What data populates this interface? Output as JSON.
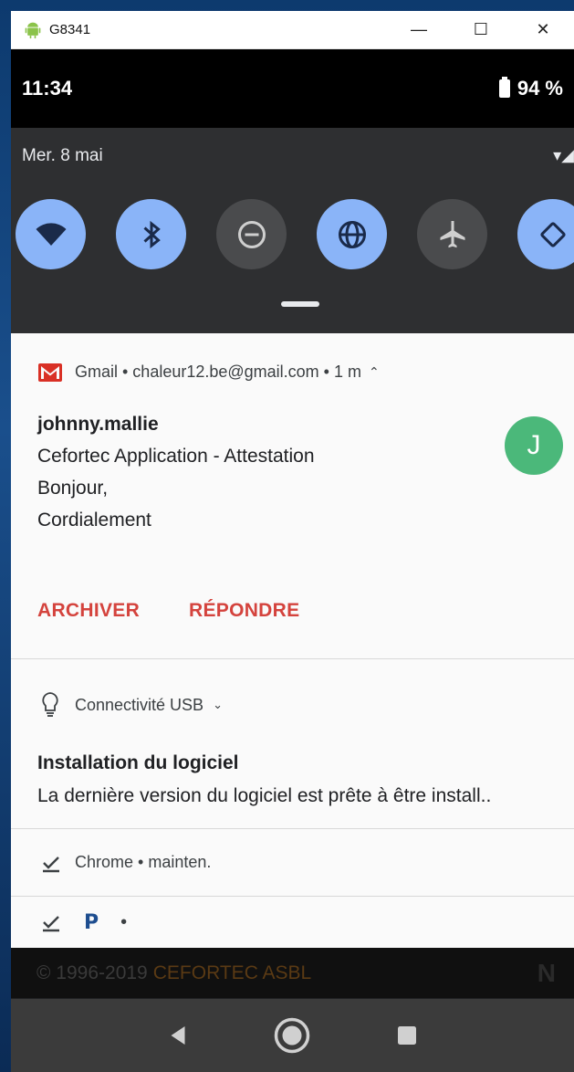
{
  "window": {
    "title": "G8341"
  },
  "statusbar": {
    "time": "11:34",
    "battery": "94 %"
  },
  "quick_settings": {
    "date": "Mer. 8 mai",
    "tiles": [
      {
        "name": "wifi",
        "state": "on"
      },
      {
        "name": "bluetooth",
        "state": "on"
      },
      {
        "name": "do-not-disturb",
        "state": "off"
      },
      {
        "name": "data-globe",
        "state": "on"
      },
      {
        "name": "airplane-mode",
        "state": "off"
      },
      {
        "name": "auto-rotate",
        "state": "on"
      }
    ]
  },
  "gmail": {
    "header": "Gmail • chaleur12.be@gmail.com • 1 m",
    "sender": "johnny.mallie",
    "subject": "Cefortec Application - Attestation",
    "line1": "Bonjour,",
    "line2": "Cordialement",
    "avatar_letter": "J",
    "actions": [
      "ARCHIVER",
      "RÉPONDRE"
    ]
  },
  "usb": {
    "header": "Connectivité USB",
    "title": "Installation du logiciel",
    "text": "La dernière version du logiciel est prête à être install.."
  },
  "chrome": {
    "header": "Chrome • mainten."
  },
  "mini": {
    "dot": "•"
  },
  "behind": {
    "copyright": "© 1996-2019",
    "brand": "CEFORTEC ASBL"
  },
  "colors": {
    "accent": "#d4433d",
    "tile_on": "#8ab4f8",
    "avatar": "#4bb87a"
  }
}
